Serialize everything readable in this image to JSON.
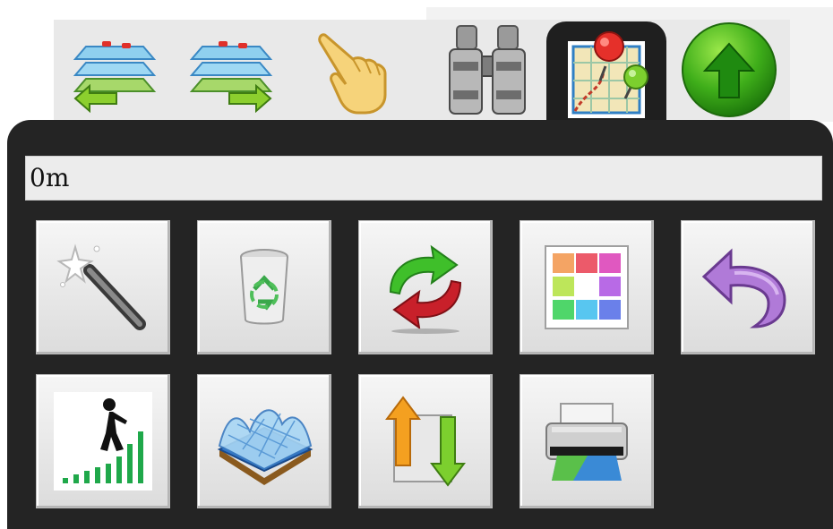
{
  "toolbar": {
    "tabs": [
      {
        "name": "layer-back-icon"
      },
      {
        "name": "layer-forward-icon"
      },
      {
        "name": "pointer-hand-icon"
      },
      {
        "name": "binoculars-icon"
      },
      {
        "name": "map-measure-icon",
        "active": true
      },
      {
        "name": "green-up-arrow-icon"
      }
    ]
  },
  "panel": {
    "distance_value": "0m",
    "tools": [
      {
        "name": "magic-wand-icon"
      },
      {
        "name": "recycle-bin-icon"
      },
      {
        "name": "swap-arrows-icon"
      },
      {
        "name": "color-palette-icon"
      },
      {
        "name": "undo-arrow-icon"
      },
      {
        "name": "elevation-profile-icon"
      },
      {
        "name": "terrain-3d-icon"
      },
      {
        "name": "up-down-transfer-icon"
      },
      {
        "name": "printer-icon"
      }
    ]
  },
  "colors": {
    "panel_bg": "#242424",
    "tab_strip": "#e9e9e9",
    "button_face": "#e6e6e6",
    "active_tab": "#1f1f1f"
  }
}
